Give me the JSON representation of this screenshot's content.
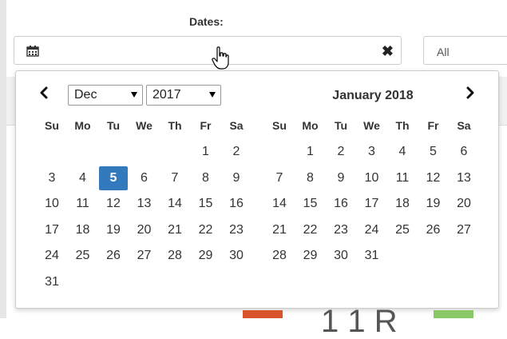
{
  "filter": {
    "label": "Dates:",
    "date_value": "",
    "secondary_select": "All"
  },
  "picker": {
    "left": {
      "month_select": "Dec",
      "year_select": "2017",
      "weekdays": [
        "Su",
        "Mo",
        "Tu",
        "We",
        "Th",
        "Fr",
        "Sa"
      ],
      "weeks": [
        [
          "",
          "",
          "",
          "",
          "",
          "1",
          "2"
        ],
        [
          "3",
          "4",
          "5",
          "6",
          "7",
          "8",
          "9"
        ],
        [
          "10",
          "11",
          "12",
          "13",
          "14",
          "15",
          "16"
        ],
        [
          "17",
          "18",
          "19",
          "20",
          "21",
          "22",
          "23"
        ],
        [
          "24",
          "25",
          "26",
          "27",
          "28",
          "29",
          "30"
        ],
        [
          "31",
          "",
          "",
          "",
          "",
          "",
          ""
        ]
      ],
      "selected_day": "5"
    },
    "right": {
      "title": "January 2018",
      "weekdays": [
        "Su",
        "Mo",
        "Tu",
        "We",
        "Th",
        "Fr",
        "Sa"
      ],
      "weeks": [
        [
          "",
          "1",
          "2",
          "3",
          "4",
          "5",
          "6"
        ],
        [
          "7",
          "8",
          "9",
          "10",
          "11",
          "12",
          "13"
        ],
        [
          "14",
          "15",
          "16",
          "17",
          "18",
          "19",
          "20"
        ],
        [
          "21",
          "22",
          "23",
          "24",
          "25",
          "26",
          "27"
        ],
        [
          "28",
          "29",
          "30",
          "31",
          "",
          "",
          ""
        ]
      ]
    }
  },
  "background": {
    "partial_text": "1 1 R"
  },
  "colors": {
    "selected": "#3379bd",
    "peek_red": "#d9532b",
    "peek_green": "#8ac765"
  }
}
